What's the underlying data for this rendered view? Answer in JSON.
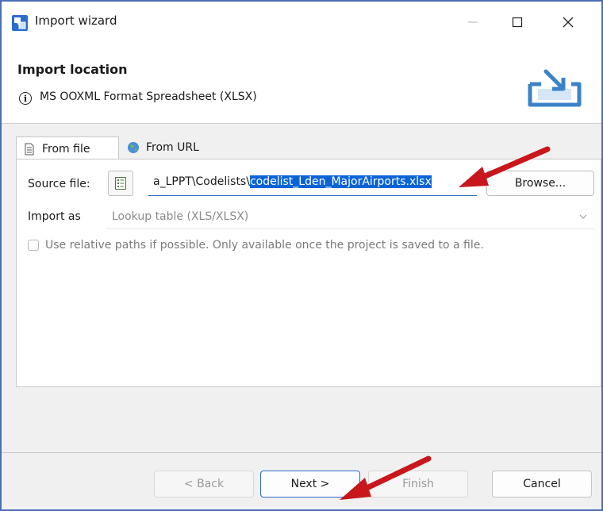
{
  "window": {
    "title": "Import wizard",
    "minimize_icon": "minimize-icon",
    "maximize_icon": "maximize-icon",
    "close_icon": "close-icon"
  },
  "header": {
    "title": "Import location",
    "description": "MS OOXML Format Spreadsheet (XLSX)",
    "info_icon": "info-icon",
    "info_glyph": "i"
  },
  "tabs": [
    {
      "label": "From file",
      "icon": "file-icon"
    },
    {
      "label": "From URL",
      "icon": "globe-icon"
    }
  ],
  "form": {
    "source_label": "Source file:",
    "source_value_prefix": "a_LPPT\\Codelists\\",
    "source_value_selected": "codelist_Lden_MajorAirports.xlsx",
    "browse_label": "Browse...",
    "import_as_label": "Import as",
    "import_as_value": "Lookup table (XLS/XLSX)",
    "relative_paths_label": "Use relative paths if possible. Only available once the project is saved to a file.",
    "relative_paths_checked": false
  },
  "footer": {
    "back_label": "< Back",
    "next_label": "Next >",
    "finish_label": "Finish",
    "cancel_label": "Cancel"
  },
  "colors": {
    "accent": "#2b6cd0",
    "selection": "#0a64d8",
    "annotation_arrow": "#c8171c"
  }
}
